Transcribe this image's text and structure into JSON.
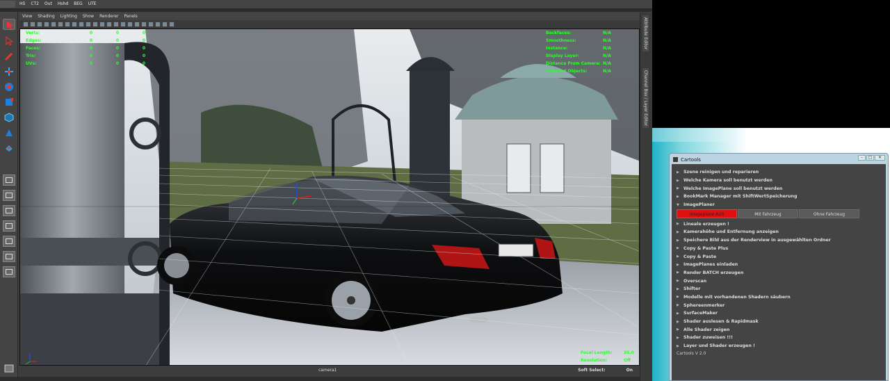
{
  "shelf_tabs": [
    "HS",
    "CT2",
    "Out",
    "Hshd",
    "BEG",
    "UTE"
  ],
  "viewport": {
    "menu": [
      "View",
      "Shading",
      "Lighting",
      "Show",
      "Renderer",
      "Panels"
    ],
    "hud_left": [
      {
        "label": "Verts:",
        "values": [
          "0",
          "0",
          "0"
        ]
      },
      {
        "label": "Edges:",
        "values": [
          "0",
          "0",
          "0"
        ]
      },
      {
        "label": "Faces:",
        "values": [
          "0",
          "0",
          "0"
        ]
      },
      {
        "label": "Tris:",
        "values": [
          "0",
          "0",
          "0"
        ]
      },
      {
        "label": "UVs:",
        "values": [
          "0",
          "0",
          "0"
        ]
      }
    ],
    "hud_right": [
      {
        "label": "Backfaces:",
        "value": "N/A"
      },
      {
        "label": "Smoothness:",
        "value": "N/A"
      },
      {
        "label": "Instance:",
        "value": "N/A"
      },
      {
        "label": "Display Layer:",
        "value": "N/A"
      },
      {
        "label": "Distance From Camera:",
        "value": "N/A"
      },
      {
        "label": "Selected Objects:",
        "value": "N/A"
      }
    ],
    "hud_bottom_right": [
      {
        "label": "Focal Length:",
        "value": "35.0"
      },
      {
        "label": "Resolution:",
        "value": "Off"
      }
    ],
    "camera": "camera1",
    "status_camera": "camera1",
    "soft_select_label": "Soft Select:",
    "soft_select_value": "On"
  },
  "side_tabs": [
    "Attribute Editor",
    "Channel Box / Layer Editor"
  ],
  "cartools": {
    "title": "Cartools",
    "items_top": [
      "Szene reinigen und reparieren",
      "Welche Kamera soll benutzt werden",
      "Welche ImagePlane soll benutzt werden",
      "BookMark Manager mit ShiftWertSpeicherung"
    ],
    "expanded_item": "ImagePlaner",
    "buttons": [
      "Imageplane AUS",
      "Mit Fahrzeug",
      "Ohne Fahrzeug"
    ],
    "items_bottom": [
      "Lineale erzeugen !",
      "Kamerahöhe und Entfernung anzeigen",
      "Speichere Bild aus der Renderview in ausgewählten Ordner",
      "Copy & Paste Plus",
      "Copy & Paste",
      "ImagePlanes einladen",
      "Render BATCH erzeugen",
      "Overscan",
      "Shifter",
      "Modelle mit vorhandenen Shadern säubern",
      "Sphereenmerker",
      "SurfaceMaker",
      "Shader auslesen & Rapidmask",
      "Alle Shader zeigen",
      "Shader zuweisen !!!",
      "Layer und Shader erzeugen !"
    ],
    "version": "Cartools V 2.0"
  },
  "colors": {
    "hud_green": "#2bff2b",
    "active_button": "#e01010",
    "panel_bg": "#444444"
  }
}
